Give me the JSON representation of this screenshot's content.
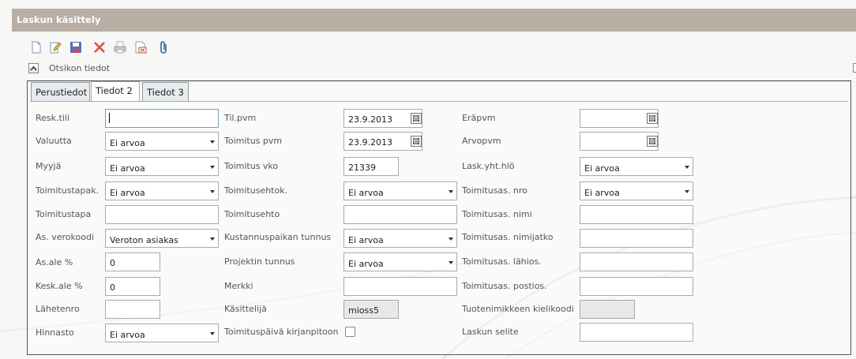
{
  "window": {
    "title": "Laskun käsittely"
  },
  "toolbar": {
    "icons": [
      "new-document-icon",
      "edit-icon",
      "save-icon",
      "delete-icon",
      "print-icon",
      "export-excel-icon",
      "attachment-icon"
    ]
  },
  "header_section": {
    "label": "Otsikon tiedot"
  },
  "tabs": [
    {
      "label": "Perustiedot",
      "active": false
    },
    {
      "label": "Tiedot 2",
      "active": true
    },
    {
      "label": "Tiedot 3",
      "active": false
    }
  ],
  "form": {
    "col1": [
      {
        "label": "Resk.tili",
        "value": "",
        "type": "text"
      },
      {
        "label": "Valuutta",
        "value": "Ei arvoa",
        "type": "select"
      },
      {
        "label": "Myyjä",
        "value": "Ei arvoa",
        "type": "select"
      },
      {
        "label": "Toimitustapak.",
        "value": "Ei arvoa",
        "type": "select"
      },
      {
        "label": "Toimitustapa",
        "value": "",
        "type": "text"
      },
      {
        "label": "As. verokoodi",
        "value": "Veroton asiakas",
        "type": "select"
      },
      {
        "label": "As.ale %",
        "value": "0",
        "type": "text"
      },
      {
        "label": "Kesk.ale %",
        "value": "0",
        "type": "text"
      },
      {
        "label": "Lähetenro",
        "value": "",
        "type": "text"
      },
      {
        "label": "Hinnasto",
        "value": "Ei arvoa",
        "type": "select"
      }
    ],
    "col2": [
      {
        "label": "Til.pvm",
        "value": "23.9.2013",
        "type": "date"
      },
      {
        "label": "Toimitus pvm",
        "value": "23.9.2013",
        "type": "date"
      },
      {
        "label": "Toimitus vko",
        "value": "21339",
        "type": "text"
      },
      {
        "label": "Toimitusehtok.",
        "value": "Ei arvoa",
        "type": "select"
      },
      {
        "label": "Toimitusehto",
        "value": "",
        "type": "text"
      },
      {
        "label": "Kustannuspaikan tunnus",
        "value": "Ei arvoa",
        "type": "select"
      },
      {
        "label": "Projektin tunnus",
        "value": "Ei arvoa",
        "type": "select"
      },
      {
        "label": "Merkki",
        "value": "",
        "type": "text"
      },
      {
        "label": "Käsittelijä",
        "value": "mioss5",
        "type": "readonly"
      },
      {
        "label": "Toimituspäivä kirjanpitoon",
        "checked": false,
        "type": "checkbox"
      }
    ],
    "col3": [
      {
        "label": "Eräpvm",
        "value": "",
        "type": "date"
      },
      {
        "label": "Arvopvm",
        "value": "",
        "type": "date"
      },
      {
        "label": "Lask.yht.hlö",
        "value": "Ei arvoa",
        "type": "select"
      },
      {
        "label": "Toimitusas. nro",
        "value": "Ei arvoa",
        "type": "select"
      },
      {
        "label": "Toimitusas. nimi",
        "value": "",
        "type": "text"
      },
      {
        "label": "Toimitusas. nimijatko",
        "value": "",
        "type": "text"
      },
      {
        "label": "Toimitusas. lähios.",
        "value": "",
        "type": "text"
      },
      {
        "label": "Toimitusas. postios.",
        "value": "",
        "type": "text"
      },
      {
        "label": "Tuotenimikkeen kielikoodi",
        "value": "",
        "type": "readonly"
      },
      {
        "label": "Laskun selite",
        "value": "",
        "type": "text"
      }
    ]
  }
}
